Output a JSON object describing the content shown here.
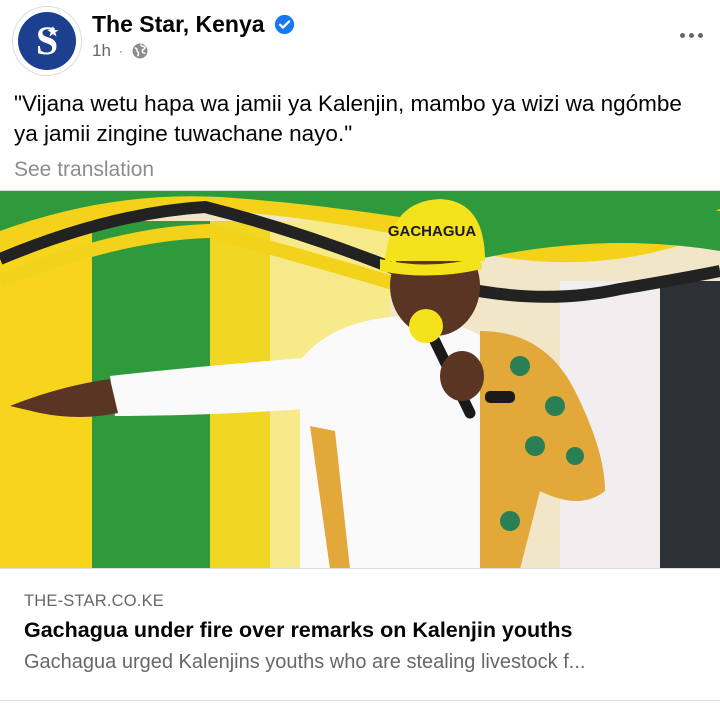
{
  "post": {
    "page_name": "The Star, Kenya",
    "time": "1h",
    "separator": "·",
    "caption": "\"Vijana wetu hapa wa jamii ya Kalenjin, mambo ya wizi wa ngómbe ya jamii zingine tuwachane nayo.\"",
    "see_translation": "See translation"
  },
  "photo": {
    "cap_text": "GACHAGUA"
  },
  "link_preview": {
    "domain": "THE-STAR.CO.KE",
    "headline": "Gachagua under fire over remarks on Kalenjin youths",
    "description": "Gachagua urged Kalenjins youths who are stealing livestock f..."
  },
  "colors": {
    "verified": "#1877f2",
    "brand_blue": "#1d3f8f",
    "meta_gray": "#65676b"
  },
  "icons": [
    "star-logo-icon",
    "verified-badge-icon",
    "globe-icon",
    "more-options-icon"
  ]
}
